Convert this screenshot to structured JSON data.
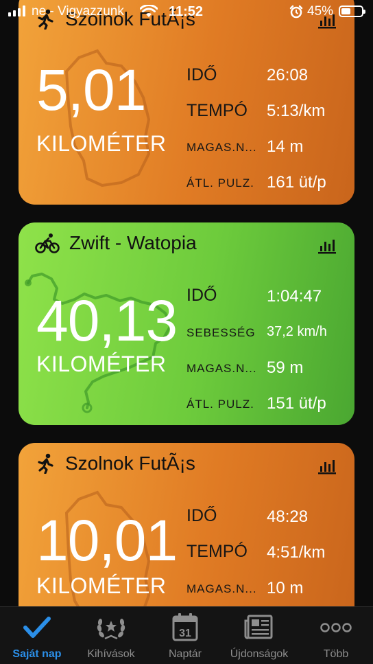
{
  "status_bar": {
    "carrier": "ne - Vigyazzunk",
    "time": "11:52",
    "battery": "45%",
    "battery_level": 0.45
  },
  "cards": [
    {
      "title": "Szolnok FutÃ¡s",
      "activity_icon": "running-icon",
      "distance": "5,01",
      "unit": "KILOMÉTER",
      "stats": [
        {
          "label": "IDŐ",
          "value": "26:08"
        },
        {
          "label": "TEMPÓ",
          "value": "5:13/km"
        },
        {
          "label": "MAGAS.N...",
          "value": "14 m"
        },
        {
          "label": "ÁTL. PULZ.",
          "value": "161 üt/p"
        }
      ]
    },
    {
      "title": "Zwift - Watopia",
      "activity_icon": "cycling-icon",
      "distance": "40,13",
      "unit": "KILOMÉTER",
      "stats": [
        {
          "label": "IDŐ",
          "value": "1:04:47"
        },
        {
          "label": "SEBESSÉG",
          "value": "37,2 km/h"
        },
        {
          "label": "MAGAS.N...",
          "value": "59 m"
        },
        {
          "label": "ÁTL. PULZ.",
          "value": "151 üt/p"
        }
      ]
    },
    {
      "title": "Szolnok FutÃ¡s",
      "activity_icon": "running-icon",
      "distance": "10,01",
      "unit": "KILOMÉTER",
      "stats": [
        {
          "label": "IDŐ",
          "value": "48:28"
        },
        {
          "label": "TEMPÓ",
          "value": "4:51/km"
        },
        {
          "label": "MAGAS.N...",
          "value": "10 m"
        }
      ]
    }
  ],
  "tabbar": {
    "items": [
      {
        "label": "Saját nap",
        "icon": "checkmark-icon",
        "active": true
      },
      {
        "label": "Kihívások",
        "icon": "laurel-icon"
      },
      {
        "label": "Naptár",
        "icon": "calendar-icon",
        "day": "31"
      },
      {
        "label": "Újdonságok",
        "icon": "news-icon"
      },
      {
        "label": "Több",
        "icon": "more-icon"
      }
    ]
  },
  "colors": {
    "run_card": "#e07b24",
    "ride_card": "#6dcb3c",
    "tab_active": "#2b8fe8",
    "background": "#0c0c0c"
  }
}
